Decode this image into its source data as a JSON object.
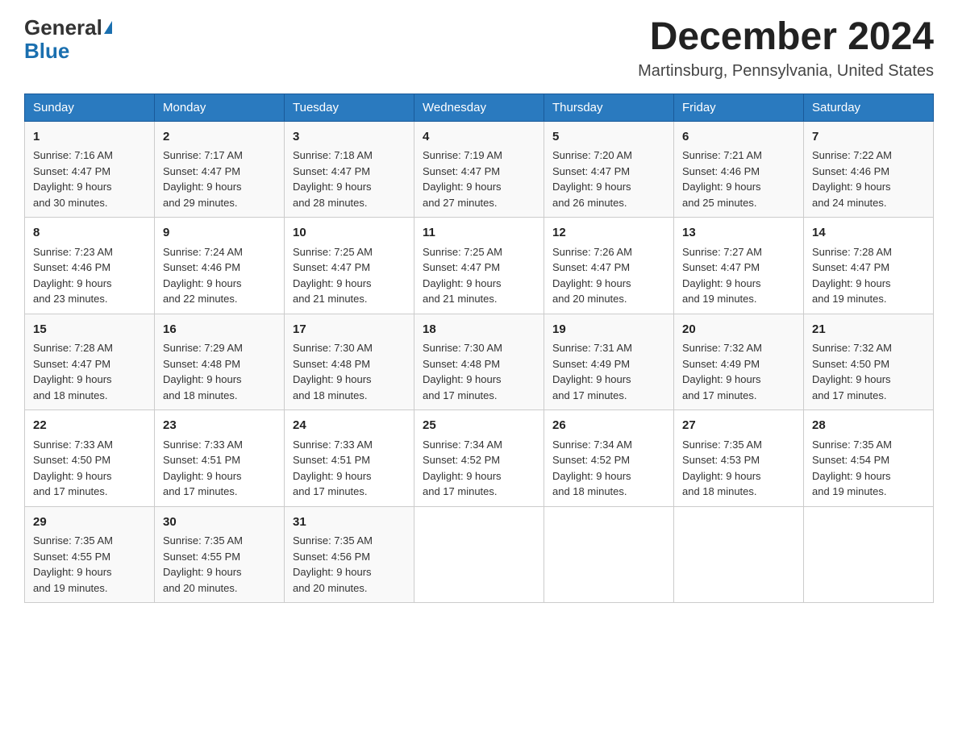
{
  "logo": {
    "general": "General",
    "blue": "Blue"
  },
  "title": "December 2024",
  "location": "Martinsburg, Pennsylvania, United States",
  "days_of_week": [
    "Sunday",
    "Monday",
    "Tuesday",
    "Wednesday",
    "Thursday",
    "Friday",
    "Saturday"
  ],
  "weeks": [
    [
      {
        "day": "1",
        "sunrise": "7:16 AM",
        "sunset": "4:47 PM",
        "daylight": "9 hours and 30 minutes."
      },
      {
        "day": "2",
        "sunrise": "7:17 AM",
        "sunset": "4:47 PM",
        "daylight": "9 hours and 29 minutes."
      },
      {
        "day": "3",
        "sunrise": "7:18 AM",
        "sunset": "4:47 PM",
        "daylight": "9 hours and 28 minutes."
      },
      {
        "day": "4",
        "sunrise": "7:19 AM",
        "sunset": "4:47 PM",
        "daylight": "9 hours and 27 minutes."
      },
      {
        "day": "5",
        "sunrise": "7:20 AM",
        "sunset": "4:47 PM",
        "daylight": "9 hours and 26 minutes."
      },
      {
        "day": "6",
        "sunrise": "7:21 AM",
        "sunset": "4:46 PM",
        "daylight": "9 hours and 25 minutes."
      },
      {
        "day": "7",
        "sunrise": "7:22 AM",
        "sunset": "4:46 PM",
        "daylight": "9 hours and 24 minutes."
      }
    ],
    [
      {
        "day": "8",
        "sunrise": "7:23 AM",
        "sunset": "4:46 PM",
        "daylight": "9 hours and 23 minutes."
      },
      {
        "day": "9",
        "sunrise": "7:24 AM",
        "sunset": "4:46 PM",
        "daylight": "9 hours and 22 minutes."
      },
      {
        "day": "10",
        "sunrise": "7:25 AM",
        "sunset": "4:47 PM",
        "daylight": "9 hours and 21 minutes."
      },
      {
        "day": "11",
        "sunrise": "7:25 AM",
        "sunset": "4:47 PM",
        "daylight": "9 hours and 21 minutes."
      },
      {
        "day": "12",
        "sunrise": "7:26 AM",
        "sunset": "4:47 PM",
        "daylight": "9 hours and 20 minutes."
      },
      {
        "day": "13",
        "sunrise": "7:27 AM",
        "sunset": "4:47 PM",
        "daylight": "9 hours and 19 minutes."
      },
      {
        "day": "14",
        "sunrise": "7:28 AM",
        "sunset": "4:47 PM",
        "daylight": "9 hours and 19 minutes."
      }
    ],
    [
      {
        "day": "15",
        "sunrise": "7:28 AM",
        "sunset": "4:47 PM",
        "daylight": "9 hours and 18 minutes."
      },
      {
        "day": "16",
        "sunrise": "7:29 AM",
        "sunset": "4:48 PM",
        "daylight": "9 hours and 18 minutes."
      },
      {
        "day": "17",
        "sunrise": "7:30 AM",
        "sunset": "4:48 PM",
        "daylight": "9 hours and 18 minutes."
      },
      {
        "day": "18",
        "sunrise": "7:30 AM",
        "sunset": "4:48 PM",
        "daylight": "9 hours and 17 minutes."
      },
      {
        "day": "19",
        "sunrise": "7:31 AM",
        "sunset": "4:49 PM",
        "daylight": "9 hours and 17 minutes."
      },
      {
        "day": "20",
        "sunrise": "7:32 AM",
        "sunset": "4:49 PM",
        "daylight": "9 hours and 17 minutes."
      },
      {
        "day": "21",
        "sunrise": "7:32 AM",
        "sunset": "4:50 PM",
        "daylight": "9 hours and 17 minutes."
      }
    ],
    [
      {
        "day": "22",
        "sunrise": "7:33 AM",
        "sunset": "4:50 PM",
        "daylight": "9 hours and 17 minutes."
      },
      {
        "day": "23",
        "sunrise": "7:33 AM",
        "sunset": "4:51 PM",
        "daylight": "9 hours and 17 minutes."
      },
      {
        "day": "24",
        "sunrise": "7:33 AM",
        "sunset": "4:51 PM",
        "daylight": "9 hours and 17 minutes."
      },
      {
        "day": "25",
        "sunrise": "7:34 AM",
        "sunset": "4:52 PM",
        "daylight": "9 hours and 17 minutes."
      },
      {
        "day": "26",
        "sunrise": "7:34 AM",
        "sunset": "4:52 PM",
        "daylight": "9 hours and 18 minutes."
      },
      {
        "day": "27",
        "sunrise": "7:35 AM",
        "sunset": "4:53 PM",
        "daylight": "9 hours and 18 minutes."
      },
      {
        "day": "28",
        "sunrise": "7:35 AM",
        "sunset": "4:54 PM",
        "daylight": "9 hours and 19 minutes."
      }
    ],
    [
      {
        "day": "29",
        "sunrise": "7:35 AM",
        "sunset": "4:55 PM",
        "daylight": "9 hours and 19 minutes."
      },
      {
        "day": "30",
        "sunrise": "7:35 AM",
        "sunset": "4:55 PM",
        "daylight": "9 hours and 20 minutes."
      },
      {
        "day": "31",
        "sunrise": "7:35 AM",
        "sunset": "4:56 PM",
        "daylight": "9 hours and 20 minutes."
      },
      null,
      null,
      null,
      null
    ]
  ],
  "labels": {
    "sunrise": "Sunrise:",
    "sunset": "Sunset:",
    "daylight": "Daylight:"
  }
}
